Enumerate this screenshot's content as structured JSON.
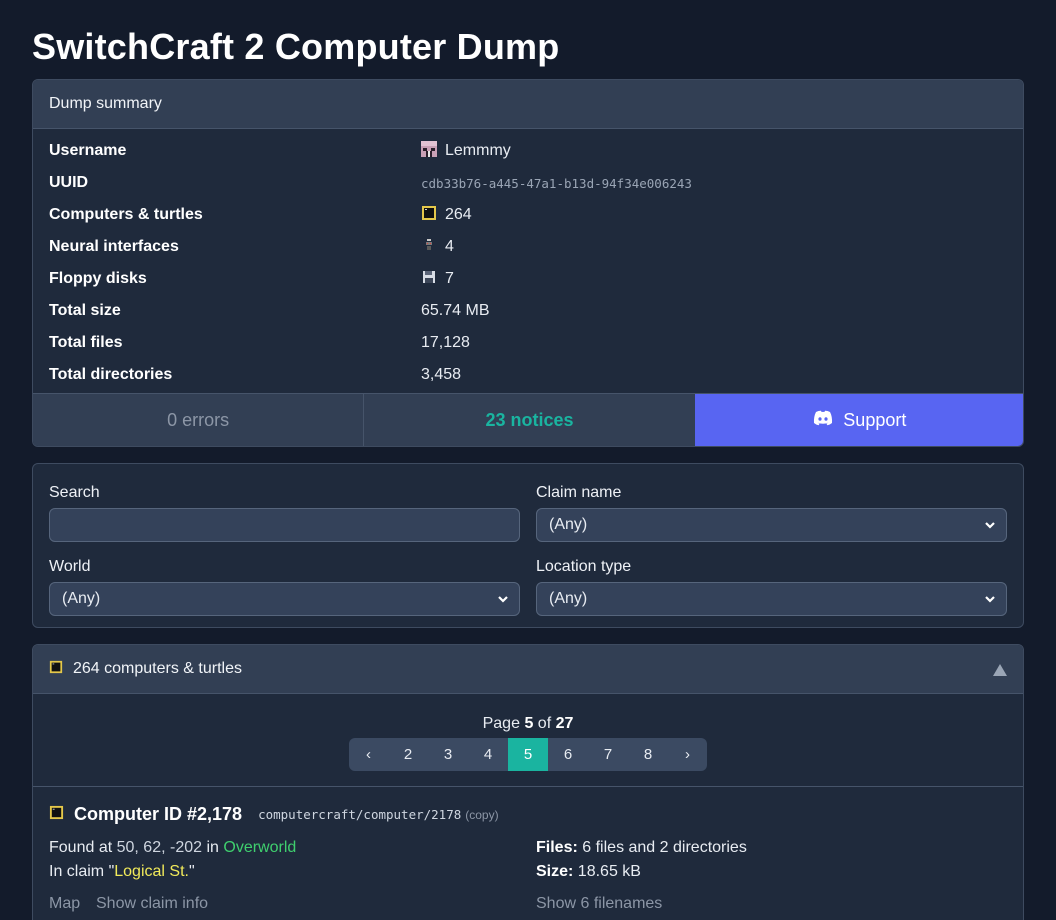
{
  "page_title": "SwitchCraft 2 Computer Dump",
  "summary": {
    "header": "Dump summary",
    "rows": [
      {
        "label": "Username",
        "value": "Lemmmy",
        "icon": "player-head-icon"
      },
      {
        "label": "UUID",
        "value": "cdb33b76-a445-47a1-b13d-94f34e006243"
      },
      {
        "label": "Computers & turtles",
        "value": "264",
        "icon": "computer-icon"
      },
      {
        "label": "Neural interfaces",
        "value": "4",
        "icon": "neural-interface-icon"
      },
      {
        "label": "Floppy disks",
        "value": "7",
        "icon": "floppy-disk-icon"
      },
      {
        "label": "Total size",
        "value": "65.74 MB"
      },
      {
        "label": "Total files",
        "value": "17,128"
      },
      {
        "label": "Total directories",
        "value": "3,458"
      }
    ],
    "errors": "0 errors",
    "notices": "23 notices",
    "support": "Support"
  },
  "filters": {
    "search_label": "Search",
    "search_value": "",
    "claim_label": "Claim name",
    "claim_value": "(Any)",
    "world_label": "World",
    "world_value": "(Any)",
    "location_label": "Location type",
    "location_value": "(Any)"
  },
  "list": {
    "header": "264 computers & turtles",
    "page_prefix": "Page",
    "page_current": "5",
    "page_of": "of",
    "page_total": "27",
    "pager": {
      "prev": "‹",
      "pages": [
        "2",
        "3",
        "4",
        "5",
        "6",
        "7",
        "8"
      ],
      "next": "›",
      "active": "5"
    },
    "computer": {
      "title": "Computer ID #2,178",
      "path": "computercraft/computer/2178",
      "copy": "(copy)",
      "found_prefix": "Found at",
      "coords": "50, 62, -202",
      "in": "in",
      "world": "Overworld",
      "claim_prefix": "In claim \"",
      "claim": "Logical St.",
      "claim_suffix": "\"",
      "files_label": "Files:",
      "files_count": "6",
      "files_word": "files and",
      "dirs_count": "2",
      "dirs_word": "directories",
      "size_label": "Size:",
      "size_value": "18.65 kB",
      "map_link": "Map",
      "claim_info_link": "Show claim info",
      "filenames_link": "Show 6 filenames"
    }
  },
  "colors": {
    "accent_teal": "#1ab4a0",
    "discord_blurple": "#5865f2",
    "world_green": "#3fcf6e",
    "claim_yellow": "#f1ea5a"
  }
}
